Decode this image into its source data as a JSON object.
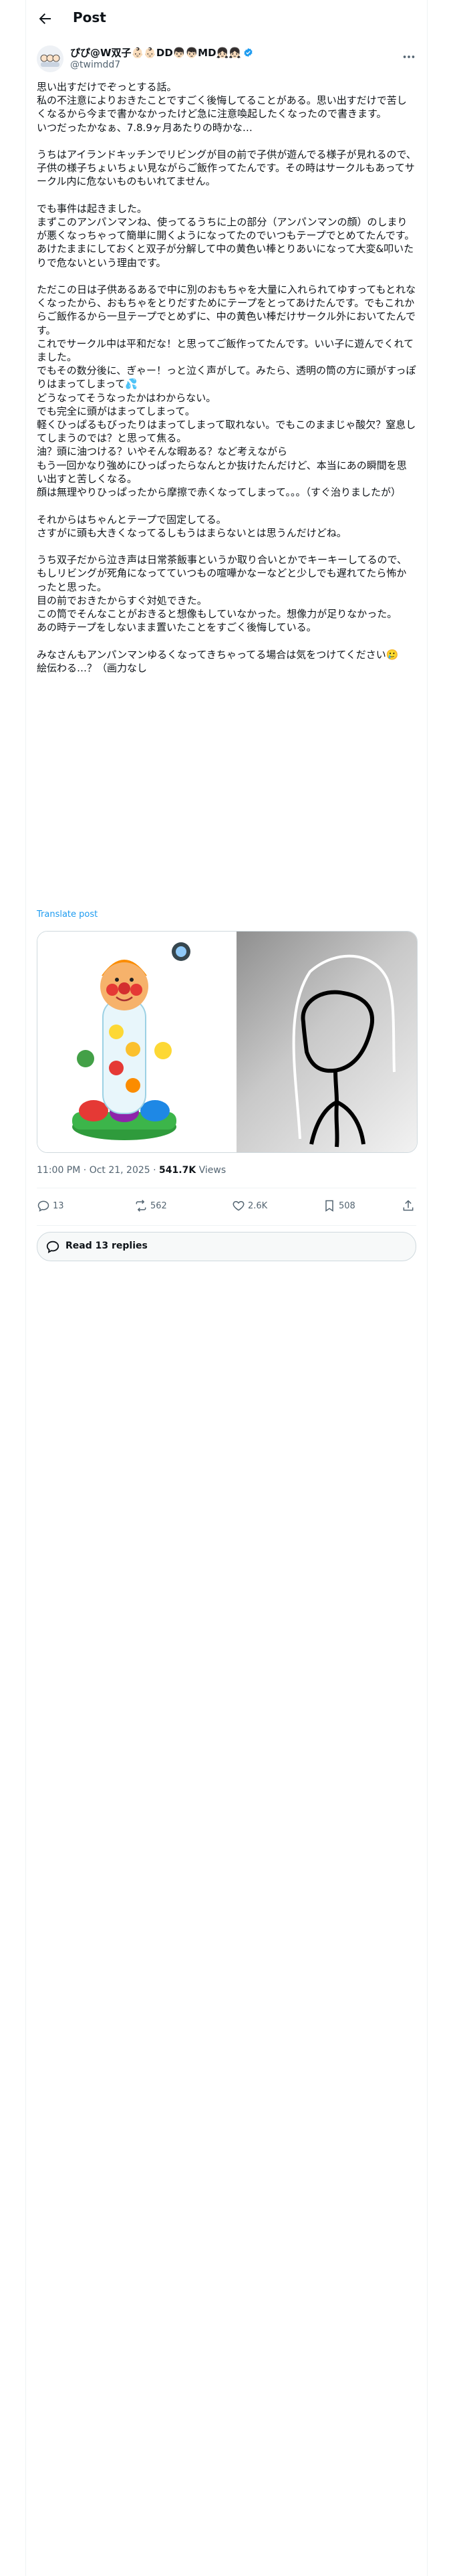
{
  "header": {
    "title": "Post",
    "back_icon": "arrow-left-icon"
  },
  "author": {
    "name": "ぴぴ@W双子👶🏻👶🏻DD👦🏻👦🏻MD👧🏻👧🏻",
    "handle": "@twimdd7",
    "verified": true,
    "verified_color": "#1d9bf0",
    "more_icon": "more-horizontal-icon"
  },
  "tweet": {
    "text": "思い出すだけでぞっとする話。\n私の不注意によりおきたことですごく後悔してることがある。思い出すだけで苦しくなるから今まで書かなかったけど急に注意喚起したくなったので書きます。\nいつだったかなぁ、7.8.9ヶ月あたりの時かな…\n\nうちはアイランドキッチンでリビングが目の前で子供が遊んでる様子が見れるので、子供の様子ちょいちょい見ながらご飯作ってたんです。その時はサークルもあってサークル内に危ないものもいれてません。\n\nでも事件は起きました。\nまずこのアンパンマンね、使ってるうちに上の部分（アンパンマンの顔）のしまりが悪くなっちゃって簡単に開くようになってたのでいつもテープでとめてたんです。\nあけたままにしておくと双子が分解して中の黄色い棒とりあいになって大変&叩いたりで危ないという理由です。\n\nただこの日は子供あるあるで中に別のおもちゃを大量に入れられてゆすってもとれなくなったから、おもちゃをとりだすためにテープをとってあけたんです。でもこれからご飯作るから一旦テープでとめずに、中の黄色い棒だけサークル外においてたんです。\nこれでサークル中は平和だな！と思ってご飯作ってたんです。いい子に遊んでくれてました。\nでもその数分後に、ぎゃー！っと泣く声がして。みたら、透明の筒の方に頭がすっぽりはまってしまって💦\nどうなってそうなったかはわからない。\nでも完全に頭がはまってしまって。\n軽くひっぱるもびったりはまってしまって取れない。でもこのままじゃ酸欠？窒息してしまうのでは？と思って焦る。\n油？頭に油つける？いやそんな暇ある？など考えながら\nもう一回かなり強めにひっぱったらなんとか抜けたんだけど、本当にあの瞬間を思い出すと苦しくなる。\n顔は無理やりひっぱったから摩擦で赤くなってしまって。。。（すぐ治りましたが）\n\nそれからはちゃんとテープで固定してる。\nさすがに頭も大きくなってるしもうはまらないとは思うんだけどね。\n\nうち双子だから泣き声は日常茶飯事というか取り合いとかでキーキーしてるので、もしリビングが死角になってていつもの喧嘩かなーなどと少しでも遅れてたら怖かったと思った。\n目の前でおきたからすぐ対処できた。\nこの筒でそんなことがおきると想像もしていなかった。想像力が足りなかった。\nあの時テープをしないまま置いたことをすごく後悔している。\n\nみなさんもアンパンマンゆるくなってきちゃってる場合は気をつけてください🥲\n絵伝わる…？（画力なし",
    "translate_label": "Translate post"
  },
  "media": [
    {
      "name": "anpanman-toy-photo"
    },
    {
      "name": "stick-figure-drawing"
    }
  ],
  "meta": {
    "time": "11:00 PM",
    "date": "Oct 21, 2025",
    "separator": "·",
    "views_count": "541.7K",
    "views_label": "Views"
  },
  "actions": {
    "reply": {
      "icon": "reply-icon",
      "count": "13"
    },
    "repost": {
      "icon": "repost-icon",
      "count": "562"
    },
    "like": {
      "icon": "heart-icon",
      "count": "2.6K"
    },
    "bookmark": {
      "icon": "bookmark-icon",
      "count": "508"
    },
    "share": {
      "icon": "share-icon"
    }
  },
  "replies_button": {
    "label": "Read 13 replies",
    "icon": "speech-bubble-icon"
  },
  "colors": {
    "accent": "#1d9bf0",
    "text": "#0f1419",
    "secondary": "#536471",
    "border": "#eff3f4"
  }
}
